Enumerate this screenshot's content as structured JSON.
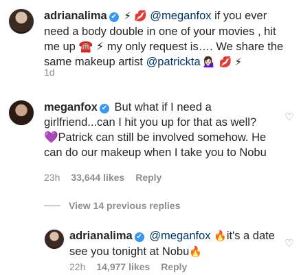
{
  "comments": [
    {
      "user": "adrianalima",
      "badge": "✔",
      "lead_emojis": "⚡ 💋",
      "mention": "@meganfox",
      "text_a": " if you ever need a body double in one of your movies , hit me up ☎️ ⚡ my only request is…. We share the same makeup artist ",
      "mention2": "@patrickta",
      "trail_emojis": " 💁🏻‍♀️ 💋 ⚡",
      "time": "1d"
    },
    {
      "user": "meganfox",
      "badge": "✔",
      "text": "But what if I need a girlfriend...can I hit you up for that as well? 💜Patrick can still be involved somehow. He can do our makeup when I take you to Nobu",
      "time": "23h",
      "likes": "33,644 likes",
      "reply": "Reply",
      "heart": "♡"
    }
  ],
  "view_replies": "View 14 previous replies",
  "reply_comment": {
    "user": "adrianalima",
    "badge": "✔",
    "mention": "@meganfox",
    "emoji1": "🔥",
    "text": "it's a date see you tonight at Nobu",
    "emoji2": "🔥",
    "time": "22h",
    "likes": "14,977 likes",
    "reply": "Reply",
    "heart": "♡"
  }
}
